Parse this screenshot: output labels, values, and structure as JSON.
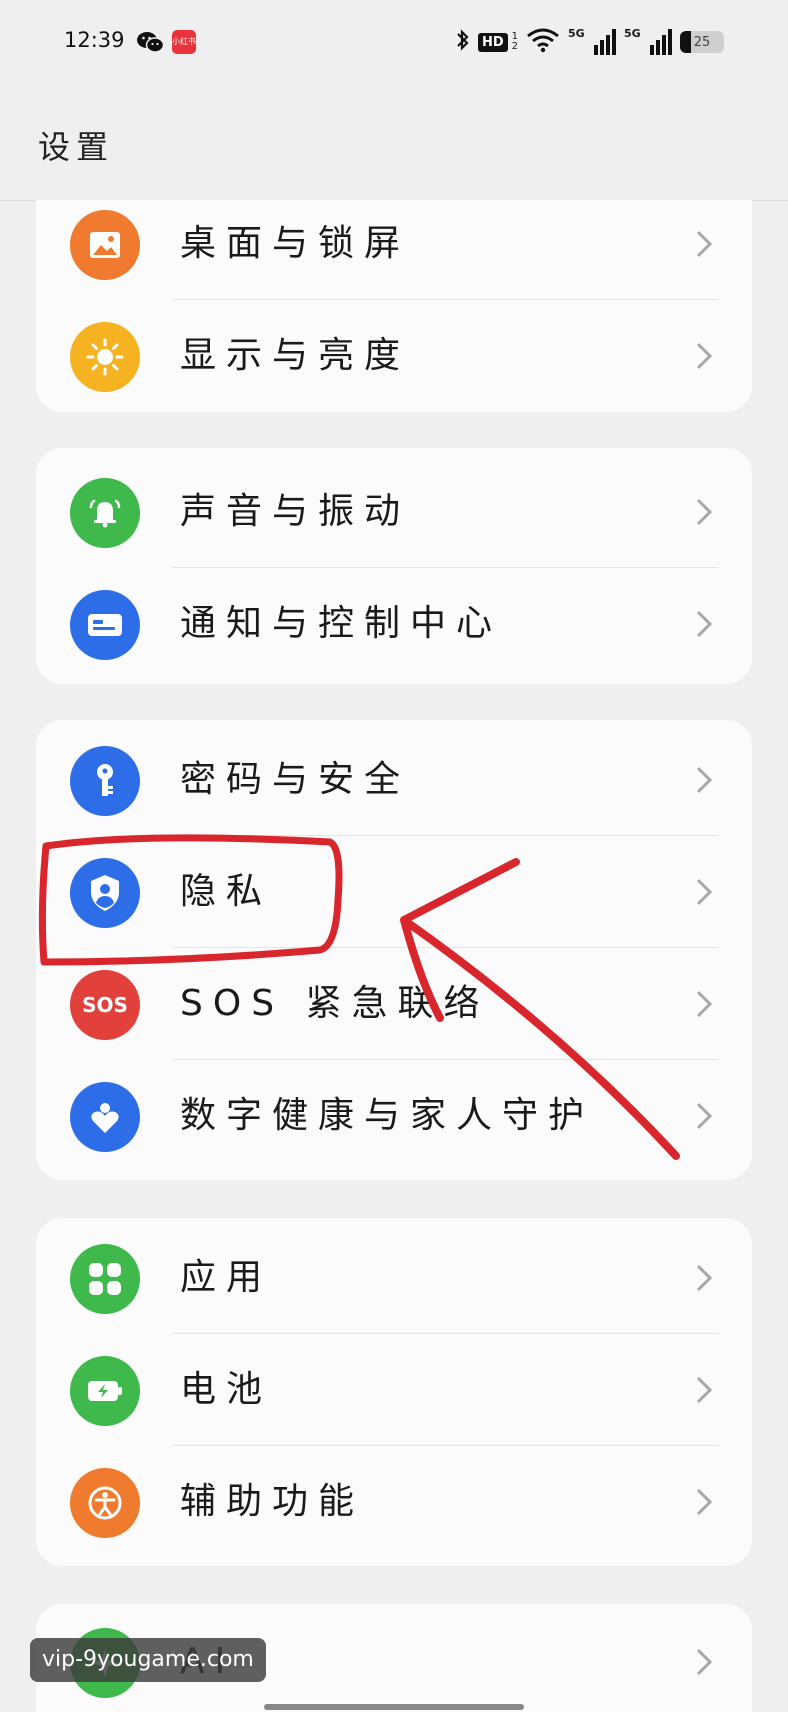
{
  "status_bar": {
    "time": "12:39",
    "app_badge_text": "小红书",
    "hd_label": "HD",
    "hd_sub_top": "1",
    "hd_sub_bottom": "2",
    "signal_label_1": "5G",
    "signal_label_2": "5G",
    "battery_level": "25",
    "battery_fraction": 0.25
  },
  "header": {
    "title": "设置"
  },
  "groups": [
    {
      "items": [
        {
          "label": "桌面与锁屏",
          "icon": "wallpaper-icon",
          "color": "#f07a2d"
        },
        {
          "label": "显示与亮度",
          "icon": "sun-icon",
          "color": "#f5b221"
        }
      ]
    },
    {
      "items": [
        {
          "label": "声音与振动",
          "icon": "bell-icon",
          "color": "#3fb94b"
        },
        {
          "label": "通知与控制中心",
          "icon": "notification-icon",
          "color": "#2d6ee8"
        }
      ]
    },
    {
      "items": [
        {
          "label": "密码与安全",
          "icon": "key-icon",
          "color": "#2d6ee8"
        },
        {
          "label": "隐私",
          "icon": "privacy-shield-icon",
          "color": "#2d6ee8"
        },
        {
          "label": "SOS 紧急联络",
          "icon": "sos-icon",
          "color": "#e2403b",
          "icon_text": "SOS"
        },
        {
          "label": "数字健康与家人守护",
          "icon": "heart-icon",
          "color": "#2d6ee8"
        }
      ]
    },
    {
      "items": [
        {
          "label": "应用",
          "icon": "apps-grid-icon",
          "color": "#3fb94b"
        },
        {
          "label": "电池",
          "icon": "battery-charge-icon",
          "color": "#3fb94b"
        },
        {
          "label": "辅助功能",
          "icon": "accessibility-icon",
          "color": "#f07a2d"
        }
      ]
    },
    {
      "items": [
        {
          "label": "AI",
          "icon": "ai-icon",
          "color": "#3fb94b"
        }
      ]
    }
  ],
  "watermark": "vip-9yougame.com",
  "annotation_color": "#d9262c"
}
